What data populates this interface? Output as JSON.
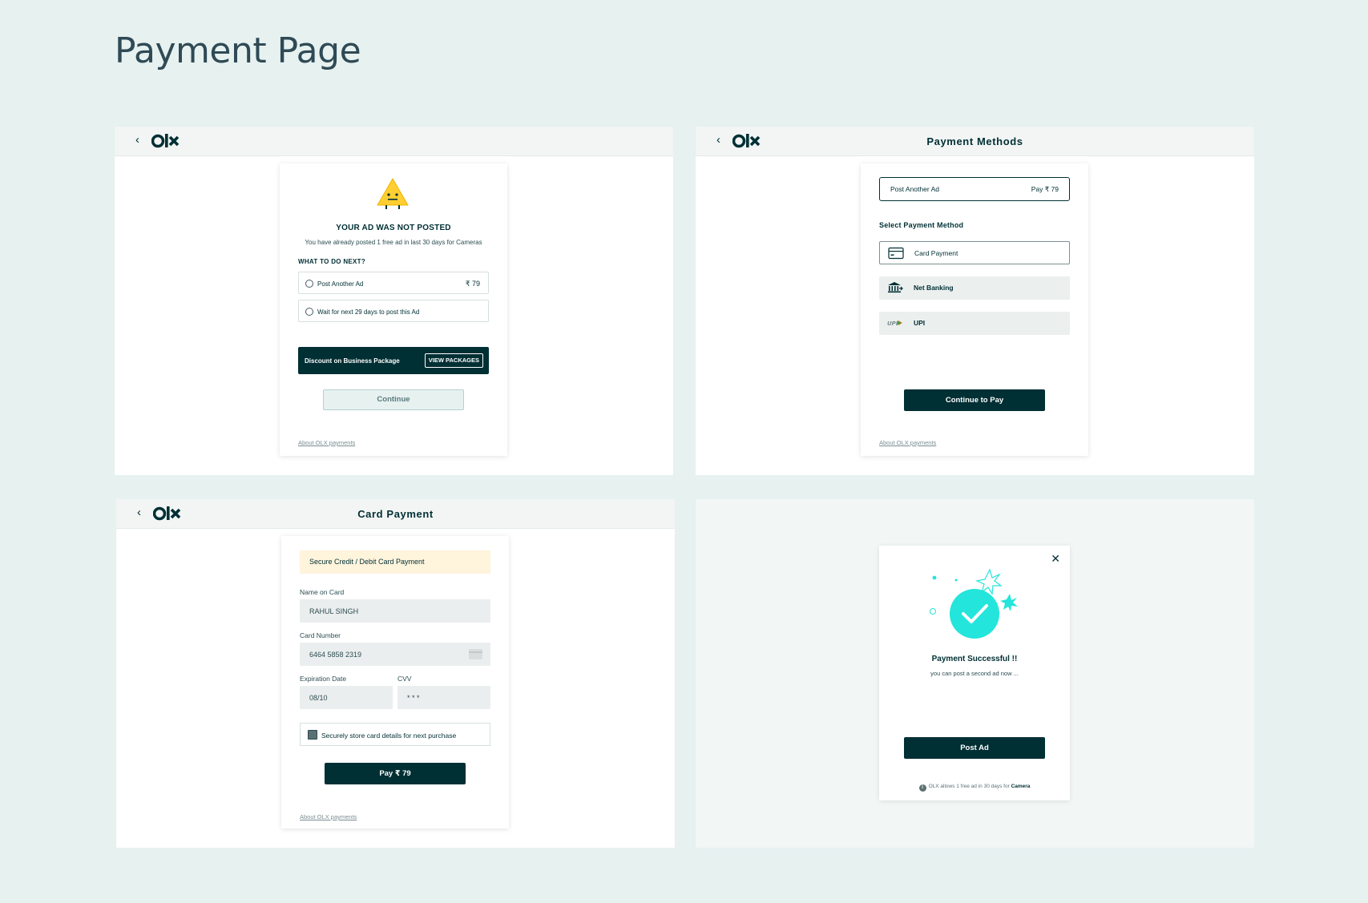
{
  "page": {
    "title": "Payment Page"
  },
  "colors": {
    "brand_dark": "#002f34",
    "background": "#e6f1f0",
    "accent_teal": "#23e5db",
    "warning_yellow": "#ffce32"
  },
  "common": {
    "about_link": "About OLX payments",
    "back_icon": "chevron-left-icon",
    "logo": "OLX"
  },
  "screen_not_posted": {
    "title": "YOUR AD WAS NOT POSTED",
    "subtitle": "You have already posted 1 free ad in last 30 days for Cameras",
    "question": "WHAT TO DO NEXT?",
    "options": [
      {
        "label": "Post Another Ad",
        "price": "₹ 79"
      },
      {
        "label": "Wait for next 29 days to post this Ad"
      }
    ],
    "promo": {
      "text": "Discount on Business Package",
      "button": "VIEW PACKAGES"
    },
    "continue": "Continue"
  },
  "screen_methods": {
    "header_title": "Payment Methods",
    "selected": {
      "label": "Post Another Ad",
      "price": "Pay ₹ 79"
    },
    "section_label": "Select Payment Method",
    "methods": [
      {
        "label": "Card Payment",
        "icon": "card-icon",
        "selected": true
      },
      {
        "label": "Net Banking",
        "icon": "bank-icon",
        "selected": false
      },
      {
        "label": "UPI",
        "icon": "upi-icon",
        "selected": false
      }
    ],
    "continue": "Continue to Pay"
  },
  "screen_card": {
    "header_title": "Card Payment",
    "banner": "Secure Credit / Debit Card Payment",
    "name_label": "Name on Card",
    "name_value": "RAHUL SINGH",
    "number_label": "Card Number",
    "number_value": "6464  5858 2319",
    "exp_label": "Expiration Date",
    "exp_value": "08/10",
    "cvv_label": "CVV",
    "cvv_value": "* * *",
    "store_label": "Securely store card details for next purchase",
    "store_checked": true,
    "pay_button": "Pay  ₹ 79"
  },
  "screen_success": {
    "title": "Payment Successful !!",
    "subtitle": "you can post a second ad now ...",
    "button": "Post Ad",
    "note": "OLX allows 1 free ad in 30 days for",
    "note_highlight": "Camera"
  }
}
